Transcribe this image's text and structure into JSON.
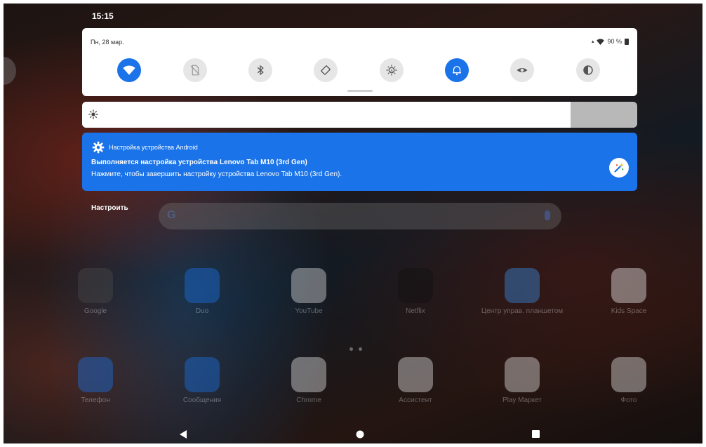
{
  "status_bar": {
    "time": "15:15"
  },
  "quick_settings": {
    "date": "Пн, 28 мар.",
    "battery": "90 %",
    "tiles": [
      {
        "name": "wifi",
        "active": true
      },
      {
        "name": "sim",
        "active": false
      },
      {
        "name": "bluetooth",
        "active": false
      },
      {
        "name": "auto-rotate",
        "active": false
      },
      {
        "name": "auto-brightness",
        "active": false
      },
      {
        "name": "notifications",
        "active": true
      },
      {
        "name": "eye-comfort",
        "active": false
      },
      {
        "name": "dark-theme",
        "active": false
      }
    ]
  },
  "brightness": {
    "level": 0.88
  },
  "notification": {
    "app_name": "Настройка устройства Android",
    "title": "Выполняется настройка устройства Lenovo Tab M10 (3rd Gen)",
    "text": "Нажмите, чтобы завершить настройку устройства Lenovo Tab M10 (3rd Gen)."
  },
  "manage_label": "Настроить",
  "home": {
    "apps_row1": [
      {
        "label": "Google",
        "icon": "google-folder-icon",
        "color": "#4a4a4a"
      },
      {
        "label": "Duo",
        "icon": "duo-icon",
        "color": "#1a73e8"
      },
      {
        "label": "YouTube",
        "icon": "youtube-icon",
        "color": "#e0e0e0"
      },
      {
        "label": "Netflix",
        "icon": "netflix-icon",
        "color": "#111111"
      },
      {
        "label": "Центр управ. планшетом",
        "icon": "tablet-center-icon",
        "color": "#3a8ee6"
      },
      {
        "label": "Kids Space",
        "icon": "kids-space-icon",
        "color": "#f0f0f0"
      }
    ],
    "apps_row2": [
      {
        "label": "Телефон",
        "icon": "phone-icon",
        "color": "#1a73e8"
      },
      {
        "label": "Сообщения",
        "icon": "messages-icon",
        "color": "#1a73e8"
      },
      {
        "label": "Chrome",
        "icon": "chrome-icon",
        "color": "#e8e8e8"
      },
      {
        "label": "Ассистент",
        "icon": "assistant-icon",
        "color": "#e8e8e8"
      },
      {
        "label": "Play Маркет",
        "icon": "play-store-icon",
        "color": "#e8e8e8"
      },
      {
        "label": "Фото",
        "icon": "photos-icon",
        "color": "#e8e8e8"
      }
    ]
  }
}
